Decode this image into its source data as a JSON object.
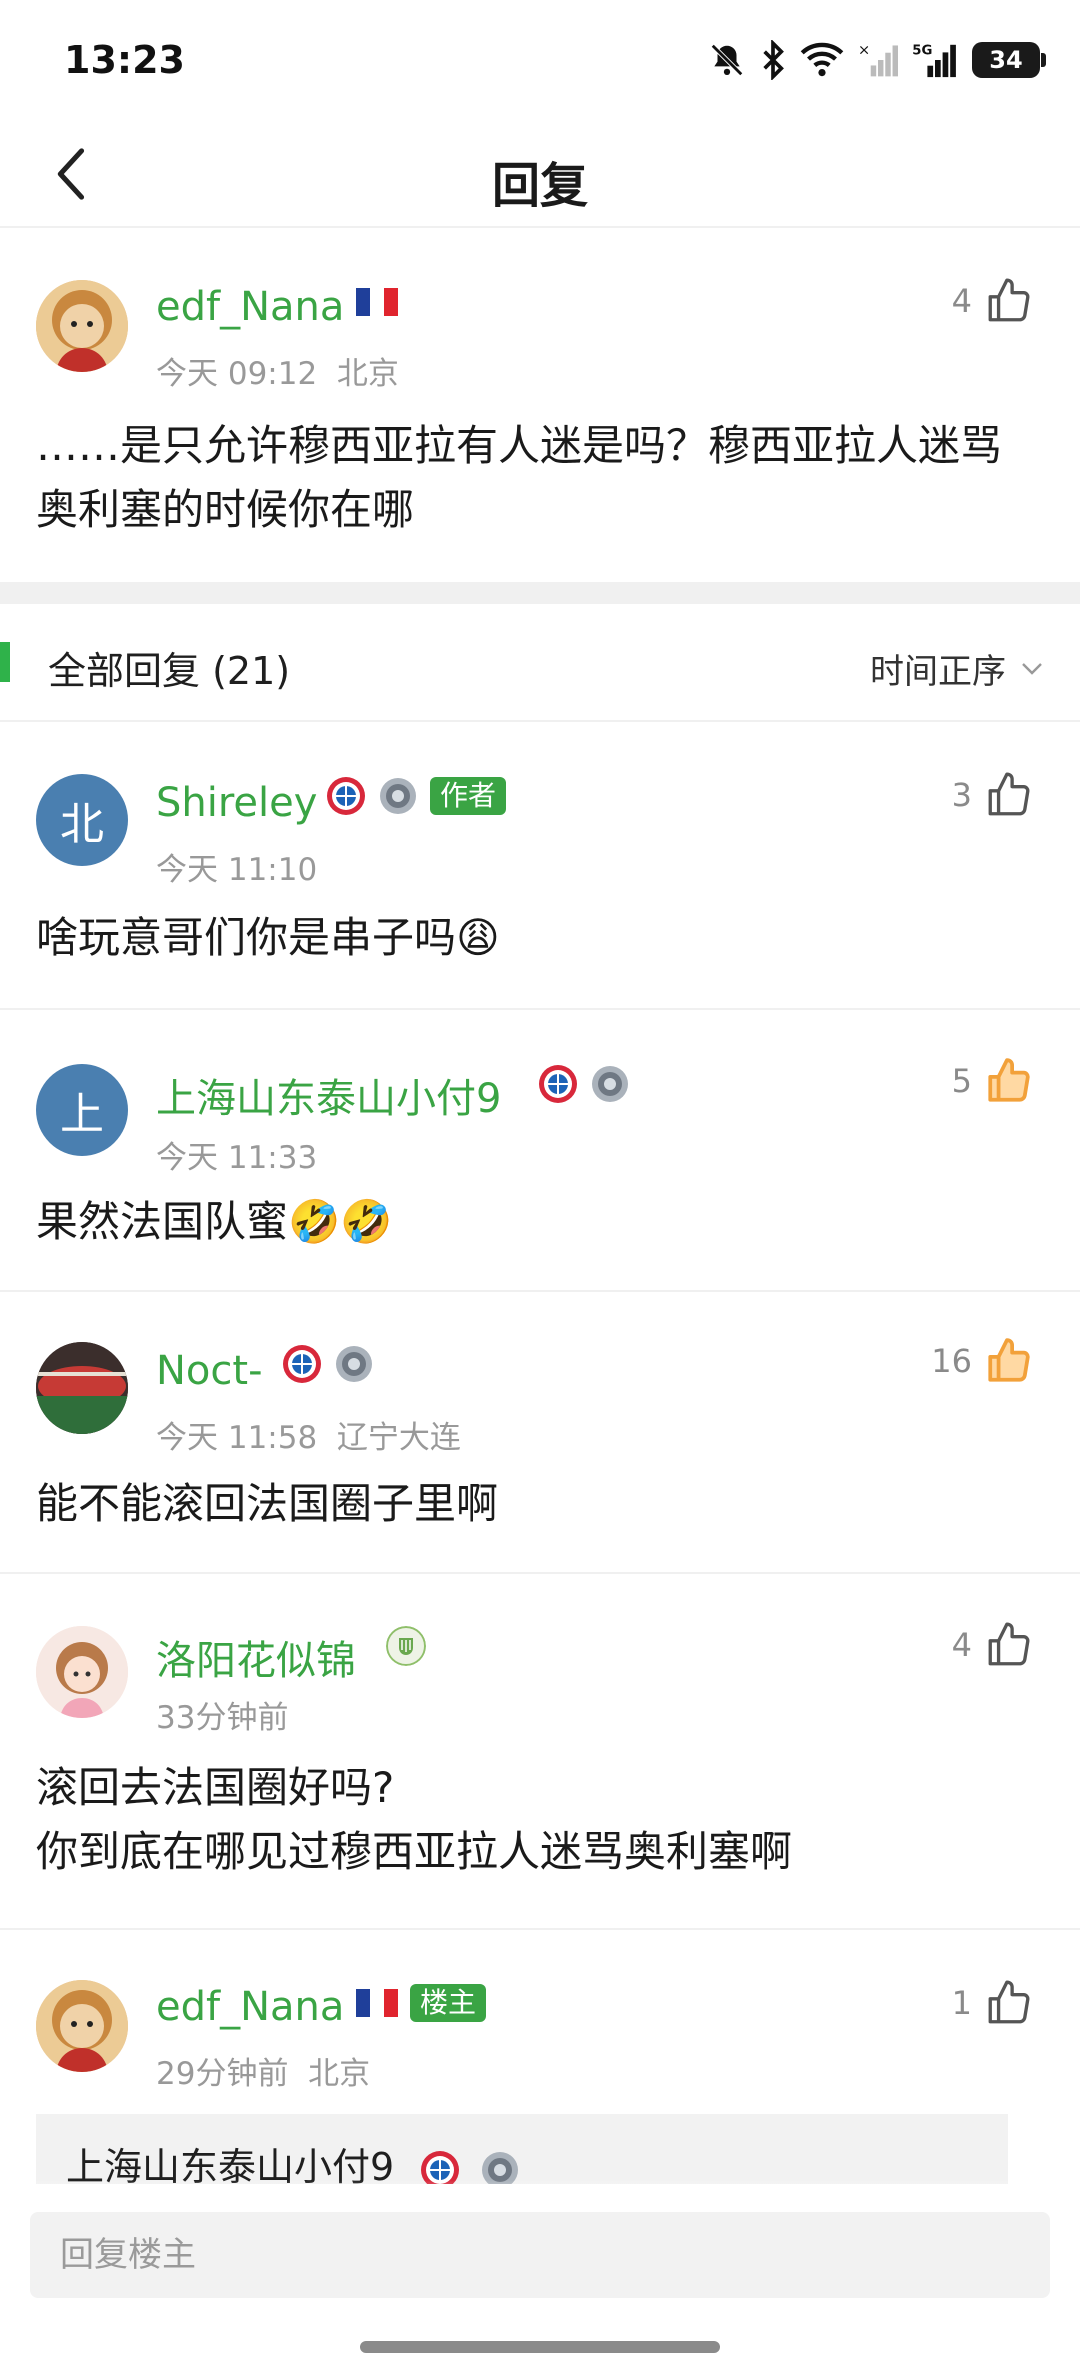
{
  "status_bar": {
    "time": "13:23",
    "battery": "34"
  },
  "nav": {
    "title": "回复"
  },
  "main_post": {
    "username": "edf_Nana",
    "likes": "4",
    "time": "今天 09:12",
    "location": "北京",
    "content": "……是只允许穆西亚拉有人迷是吗？穆西亚拉人迷骂奥利塞的时候你在哪"
  },
  "replies_header": {
    "title": "全部回复 (21)",
    "sort_label": "时间正序"
  },
  "replies": [
    {
      "username": "Shireley",
      "avatar_letter": "北",
      "tag": "作者",
      "time": "今天 11:10",
      "location": "",
      "likes": "3",
      "liked": false,
      "content": "啥玩意哥们你是串子吗😩"
    },
    {
      "username": "上海山东泰山小付9",
      "avatar_letter": "上",
      "tag": "",
      "time": "今天 11:33",
      "location": "",
      "likes": "5",
      "liked": true,
      "content": "果然法国队蜜🤣🤣"
    },
    {
      "username": "Noct-",
      "tag": "",
      "time": "今天 11:58",
      "location": "辽宁大连",
      "likes": "16",
      "liked": true,
      "content": "能不能滚回法国圈子里啊"
    },
    {
      "username": "洛阳花似锦",
      "tag": "",
      "time": "33分钟前",
      "location": "",
      "likes": "4",
      "liked": false,
      "content_lines": [
        "滚回去法国圈好吗?",
        "你到底在哪见过穆西亚拉人迷骂奥利塞啊"
      ]
    },
    {
      "username": "edf_Nana",
      "tag": "楼主",
      "time": "29分钟前",
      "location": "北京",
      "likes": "1",
      "liked": false,
      "quote_user": "上海山东泰山小付9"
    }
  ],
  "input": {
    "placeholder": "回复楼主"
  },
  "colors": {
    "accent": "#3aa444",
    "like_active": "#f2a13a"
  }
}
